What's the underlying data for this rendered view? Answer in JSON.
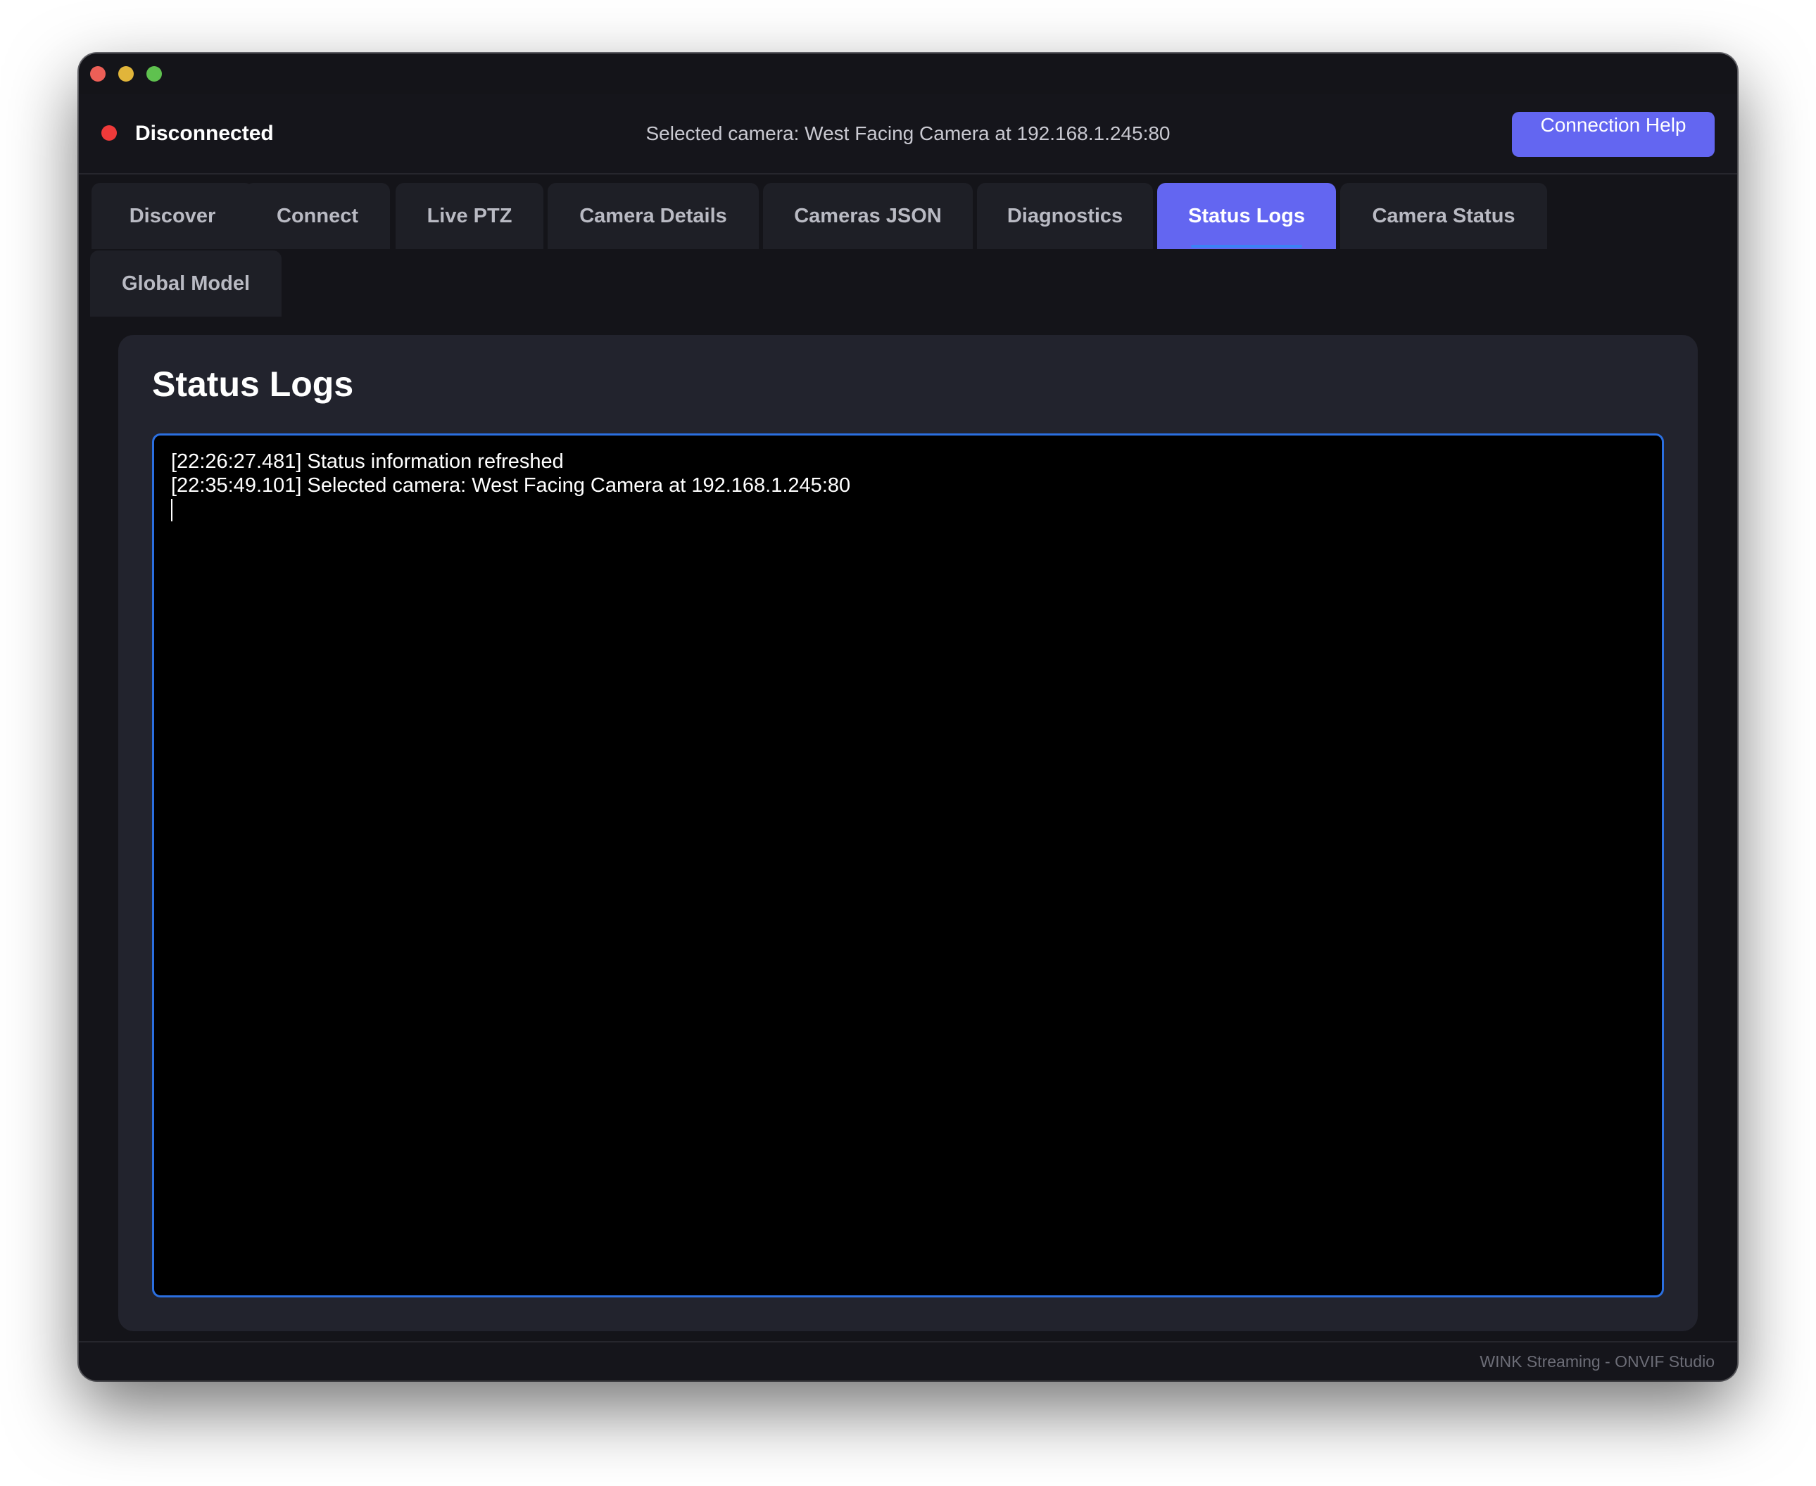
{
  "status": {
    "label": "Disconnected",
    "color": "#ef3a3a",
    "selected_camera": "Selected camera: West Facing Camera at 192.168.1.245:80",
    "help_button": "Connection Help"
  },
  "tabs": [
    {
      "label": "Discover",
      "active": false
    },
    {
      "label": "Connect",
      "active": false
    },
    {
      "label": "Live PTZ",
      "active": false
    },
    {
      "label": "Camera Details",
      "active": false
    },
    {
      "label": "Cameras JSON",
      "active": false
    },
    {
      "label": "Diagnostics",
      "active": false
    },
    {
      "label": "Status Logs",
      "active": true
    },
    {
      "label": "Camera Status",
      "active": false
    },
    {
      "label": "Global Model",
      "active": false
    }
  ],
  "panel": {
    "title": "Status Logs",
    "log_lines": [
      "[22:26:27.481] Status information refreshed",
      "[22:35:49.101] Selected camera: West Facing Camera at 192.168.1.245:80"
    ]
  },
  "footer": {
    "text": "WINK Streaming - ONVIF Studio"
  },
  "colors": {
    "accent": "#6366f1",
    "focus_border": "#2b6fe0",
    "background": "#141419"
  }
}
